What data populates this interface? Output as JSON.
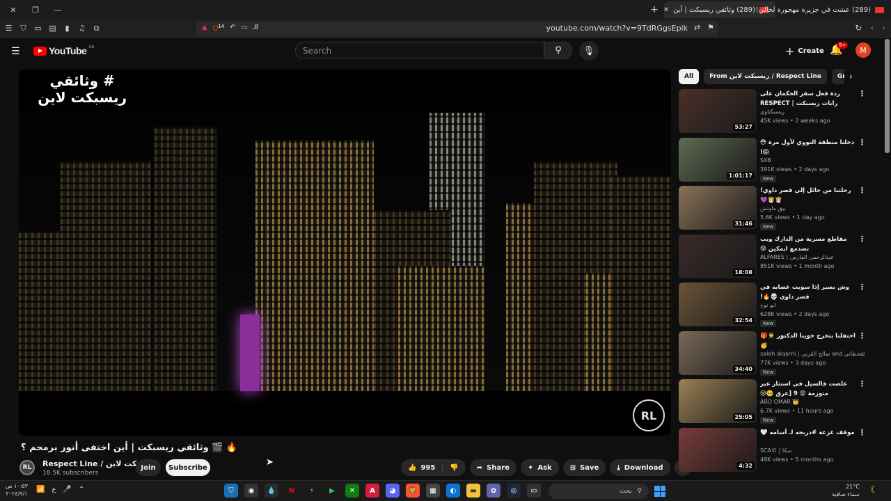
{
  "browser": {
    "tabs": [
      {
        "title": "(289) وثائقي ريسبكت | أين",
        "active": true
      },
      {
        "title": "(289) عشت في جزيرة مهجورة لحالي!",
        "active": false
      }
    ],
    "url": "youtube.com/watch?v=9TdRGgsEpik",
    "shield_count": "14"
  },
  "youtube": {
    "logo_text": "YouTube",
    "region": "SA",
    "search_placeholder": "Search",
    "create_label": "Create",
    "notif_badge": "9+",
    "avatar_letter": "M"
  },
  "video": {
    "overlay_title": "# وثائقي\nريسبكت لاين",
    "title": "وثائقي ريسبكت | أين اختفى أنور برمحم ؟ 🎬 🔥",
    "channel": "Respect Line / ريسبكت لاين",
    "subscribers": "18.5K subscribers",
    "join_label": "Join",
    "subscribe_label": "Subscribe",
    "likes": "995",
    "share_label": "Share",
    "ask_label": "Ask",
    "save_label": "Save",
    "download_label": "Download"
  },
  "chips": [
    "All",
    "From ريسبكت لاين / Respect Line",
    "Grand Theft"
  ],
  "recommendations": [
    {
      "title": "ردة فعل سفر الحكمان على رابات ريسبكت | RESPECT",
      "channel": "ريسبكتاوي",
      "meta": "45K views • 2 weeks ago",
      "duration": "53:27",
      "is_new": false,
      "thumb": "#4a3028"
    },
    {
      "title": "دخلنا منطقة النووي لأول مرة 😳😱!",
      "channel": "SXB",
      "meta": "391K views • 2 days ago",
      "duration": "1:01:17",
      "is_new": true,
      "thumb": "#5f6a52"
    },
    {
      "title": "رحلتنا من حائل إلى قصر داوي! 👸🏻🤴🏻💜",
      "channel": "بيق ماوتش",
      "meta": "5.6K views • 1 day ago",
      "duration": "31:46",
      "is_new": true,
      "thumb": "#8a7356"
    },
    {
      "title": "مقاطع مسربة من الدارك ويب تصدمع ابمكين 😰",
      "channel": "ALFARES | عبدالرحمن الفارس",
      "meta": "851K views • 1 month ago",
      "duration": "18:08",
      "is_new": false,
      "thumb": "#3b2a2a"
    },
    {
      "title": "وش يصير إذا سويت عصابه في قصر داوي 💀🔥!",
      "channel": "ابو نوح",
      "meta": "628K views • 2 days ago",
      "duration": "32:54",
      "is_new": true,
      "thumb": "#6b5436"
    },
    {
      "title": "احتفلنا بتخرج خوينا الدكتور 👨‍🎓🎁🥳",
      "channel": "saleh alqarni | صالح القرني and سعيد القحطاني",
      "meta": "77K views • 3 days ago",
      "duration": "34:40",
      "is_new": true,
      "thumb": "#7a6a58"
    },
    {
      "title": "علصت فالسيل في استثار عبر متوزمة 😡 9 [عرق 🥺😢",
      "channel": "ABO OMAR 👑",
      "meta": "6.7K views • 11 hours ago",
      "duration": "25:05",
      "is_new": true,
      "thumb": "#9c8154"
    },
    {
      "title": "موقف غزعة #دريجه لـ أسامه 🤍",
      "channel": "SCA© | سكا",
      "meta": "48K views • 5 months ago",
      "duration": "4:32",
      "is_new": false,
      "thumb": "#7a3b3b"
    }
  ],
  "taskbar": {
    "time": "١٠:٥٣ ص",
    "date": "٢٠٢٤/٧/١",
    "search_label": "بحث",
    "temperature": "21°C",
    "weather": "سماء صافية"
  }
}
